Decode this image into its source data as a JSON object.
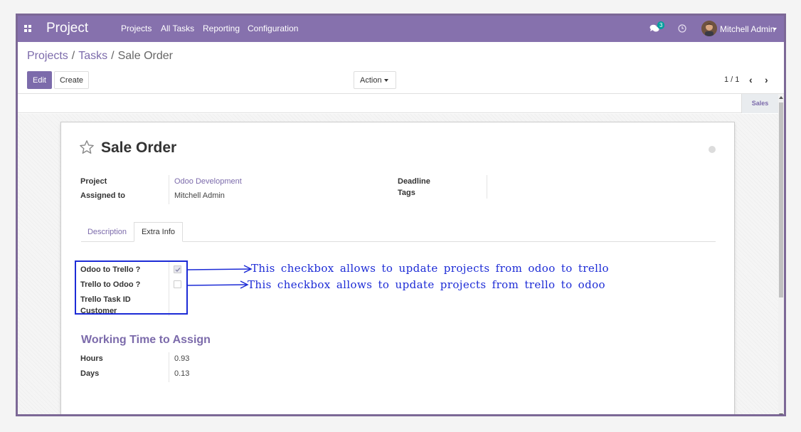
{
  "navbar": {
    "app_title": "Project",
    "menus": [
      "Projects",
      "All Tasks",
      "Reporting",
      "Configuration"
    ],
    "chat_count": "3",
    "user_name": "Mitchell Admin"
  },
  "breadcrumb": {
    "items": [
      "Projects",
      "Tasks"
    ],
    "current": "Sale Order",
    "separator": "/"
  },
  "toolbar": {
    "edit_label": "Edit",
    "create_label": "Create",
    "action_label": "Action",
    "pager": "1 / 1"
  },
  "statusbar": {
    "stage": "Sales"
  },
  "record": {
    "title": "Sale Order",
    "project_label": "Project",
    "project_value": "Odoo Development",
    "assigned_label": "Assigned to",
    "assigned_value": "Mitchell Admin",
    "deadline_label": "Deadline",
    "tags_label": "Tags"
  },
  "tabs": [
    "Description",
    "Extra Info"
  ],
  "extra_info": {
    "odoo_to_trello_label": "Odoo to Trello ?",
    "odoo_to_trello_checked": true,
    "trello_to_odoo_label": "Trello to Odoo ?",
    "trello_to_odoo_checked": false,
    "trello_task_id_label": "Trello Task ID",
    "customer_label": "Customer"
  },
  "annotations": [
    "This checkbox allows to update projects from odoo to trello",
    "This checkbox allows to update projects from trello to odoo"
  ],
  "working_time": {
    "heading": "Working Time to Assign",
    "hours_label": "Hours",
    "hours_value": "0.93",
    "days_label": "Days",
    "days_value": "0.13"
  },
  "colors": {
    "brand": "#8671ad",
    "link": "#7c6bab",
    "annotation": "#1c2bd6"
  }
}
